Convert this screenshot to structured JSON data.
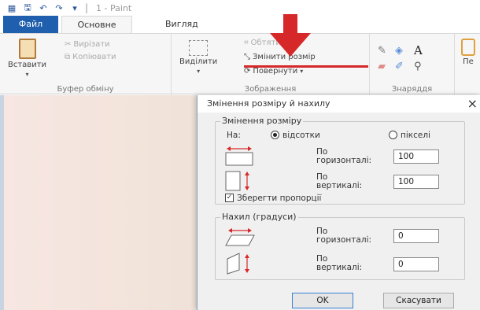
{
  "titlebar": {
    "title": "1 - Paint",
    "separator": "|"
  },
  "tabs": {
    "file": "Файл",
    "home": "Основне",
    "view": "Вигляд"
  },
  "ribbon": {
    "paste": "Вставити",
    "cut": "Вирізати",
    "copy": "Копіювати",
    "clipboard_group": "Буфер обміну",
    "select": "Виділити",
    "crop": "Обтяти",
    "resize": "Змінити розмір",
    "rotate": "Повернути",
    "image_group": "Зображення",
    "tools_group": "Знаряддя",
    "brush_partial": "Пе"
  },
  "dialog": {
    "title": "Змінення розміру й нахилу",
    "resize_section": "Змінення розміру",
    "by": "На:",
    "percent": "відсотки",
    "pixels": "пікселі",
    "horizontal_label_1": "По",
    "horizontal_label_2": "горизонталі:",
    "vertical_label_1": "По",
    "vertical_label_2": "вертикалі:",
    "resize_h": "100",
    "resize_v": "100",
    "keep_ratio": "Зберегти пропорції",
    "skew_section": "Нахил (градуси)",
    "skew_h": "0",
    "skew_v": "0",
    "ok": "OK",
    "cancel": "Скасувати",
    "close": "×"
  },
  "colors": {
    "accent": "#1f5fad",
    "arrow": "#d62828"
  }
}
